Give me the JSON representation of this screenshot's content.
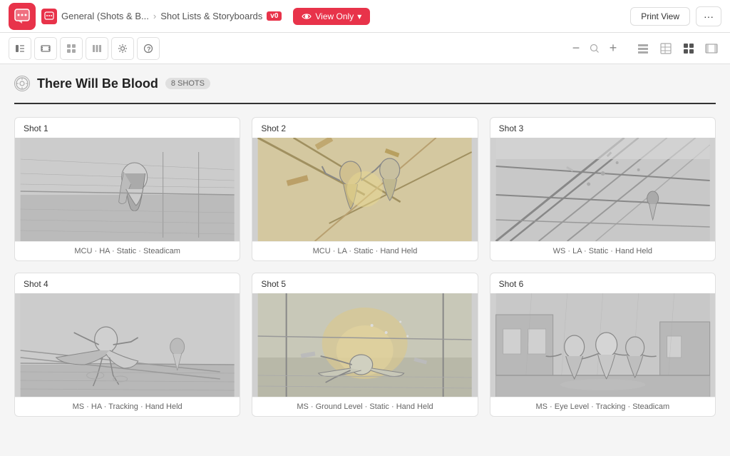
{
  "app": {
    "icon": "💬",
    "breadcrumb_icon": "💬",
    "breadcrumb_parent": "General (Shots & B...",
    "breadcrumb_current": "Shot Lists & Storyboards",
    "version": "v0",
    "view_only_label": "View Only",
    "print_view_label": "Print View",
    "more_label": "···"
  },
  "toolbar": {
    "icons": [
      "▤",
      "▭",
      "⊞",
      "▥",
      "⚙",
      "?"
    ],
    "zoom_minus": "−",
    "zoom_plus": "+",
    "view_icons": [
      "☰",
      "▦",
      "⊞",
      "▬"
    ]
  },
  "scene": {
    "title": "There Will Be Blood",
    "shots_count": "8 SHOTS"
  },
  "shots": [
    {
      "id": "shot-1",
      "label": "Shot 1",
      "meta": "MCU · HA · Static · Steadicam"
    },
    {
      "id": "shot-2",
      "label": "Shot 2",
      "meta": "MCU · LA · Static · Hand Held"
    },
    {
      "id": "shot-3",
      "label": "Shot 3",
      "meta": "WS · LA · Static · Hand Held"
    },
    {
      "id": "shot-4",
      "label": "Shot 4",
      "meta": "MS · HA · Tracking · Hand Held"
    },
    {
      "id": "shot-5",
      "label": "Shot 5",
      "meta": "MS · Ground Level · Static · Hand Held"
    },
    {
      "id": "shot-6",
      "label": "Shot 6",
      "meta": "MS · Eye Level · Tracking · Steadicam"
    }
  ]
}
